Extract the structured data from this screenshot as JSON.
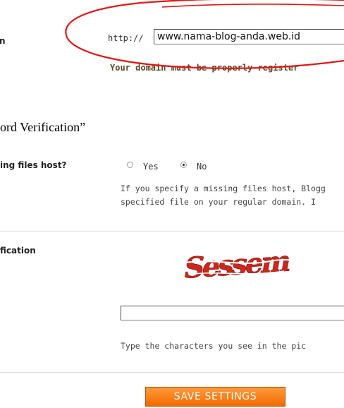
{
  "domain": {
    "label": "n",
    "prefix": "http://",
    "value": "www.nama-blog-anda.web.id",
    "warning": "Your domain must be properly register"
  },
  "section_heading": "ord Verification”",
  "missing_files_host": {
    "label": "ing files host?",
    "options": [
      "Yes",
      "No"
    ],
    "selected": "No",
    "help_line1": "If you specify a missing files host, Blogg",
    "help_line2": "specified file on your regular domain. I"
  },
  "word_verification": {
    "label": "fication",
    "captcha_text": "Sessem",
    "help": "Type the characters you see in the pic"
  },
  "save_button": {
    "label": "SAVE SETTINGS"
  },
  "colors": {
    "annotation_red": "#e01818",
    "button_orange": "#f57c12",
    "captcha_red": "#c8281e"
  }
}
